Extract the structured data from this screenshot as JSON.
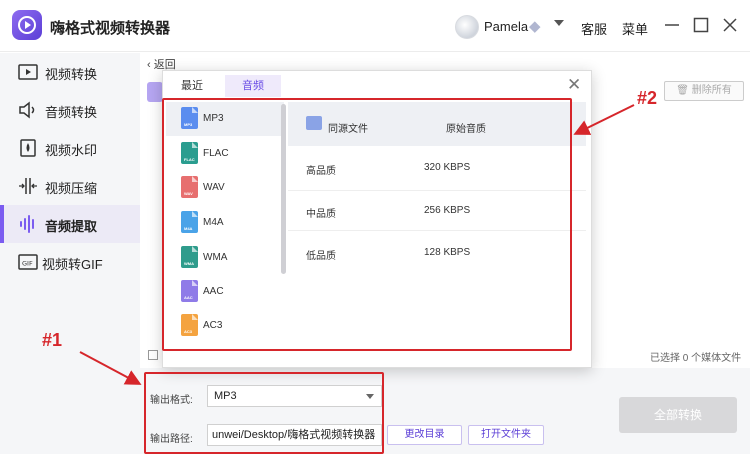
{
  "app": {
    "title": "嗨格式视频转换器",
    "username": "Pamela",
    "service_label": "客服",
    "menu_label": "菜单"
  },
  "sidebar": {
    "items": [
      {
        "label": "视频转换",
        "icon": "video-convert-icon"
      },
      {
        "label": "音频转换",
        "icon": "audio-convert-icon"
      },
      {
        "label": "视频水印",
        "icon": "watermark-icon"
      },
      {
        "label": "视频压缩",
        "icon": "compress-icon"
      },
      {
        "label": "音频提取",
        "icon": "audio-extract-icon",
        "active": true
      },
      {
        "label": "视频转GIF",
        "icon": "gif-icon"
      }
    ]
  },
  "main": {
    "back_label": "返回",
    "delete_all_label": "删除所有",
    "selected_count_label": "已选择 0 个媒体文件"
  },
  "dialog": {
    "tabs": [
      {
        "label": "最近"
      },
      {
        "label": "音频",
        "active": true
      }
    ],
    "formats": [
      {
        "label": "MP3",
        "tag": "MP3",
        "color": "#5b8def",
        "selected": true
      },
      {
        "label": "FLAC",
        "tag": "FLAC",
        "color": "#2a9d8f"
      },
      {
        "label": "WAV",
        "tag": "WAV",
        "color": "#e76f6f"
      },
      {
        "label": "M4A",
        "tag": "M4A",
        "color": "#4aa3e8"
      },
      {
        "label": "WMA",
        "tag": "WMA",
        "color": "#2f9c8c"
      },
      {
        "label": "AAC",
        "tag": "AAC",
        "color": "#8f7be8"
      },
      {
        "label": "AC3",
        "tag": "AC3",
        "color": "#f4a340"
      }
    ],
    "qualities": [
      {
        "name": "同源文件",
        "value": "原始音质",
        "selected": true
      },
      {
        "name": "高品质",
        "value": "320 KBPS"
      },
      {
        "name": "中品质",
        "value": "256 KBPS"
      },
      {
        "name": "低品质",
        "value": "128 KBPS"
      }
    ]
  },
  "output": {
    "format_label": "输出格式:",
    "format_value": "MP3",
    "path_label": "输出路径:",
    "path_value": "unwei/Desktop/嗨格式视频转换器",
    "change_dir_label": "更改目录",
    "open_folder_label": "打开文件夹",
    "convert_all_label": "全部转换"
  },
  "annotations": {
    "label_1": "#1",
    "label_2": "#2",
    "color": "#d6262b"
  }
}
